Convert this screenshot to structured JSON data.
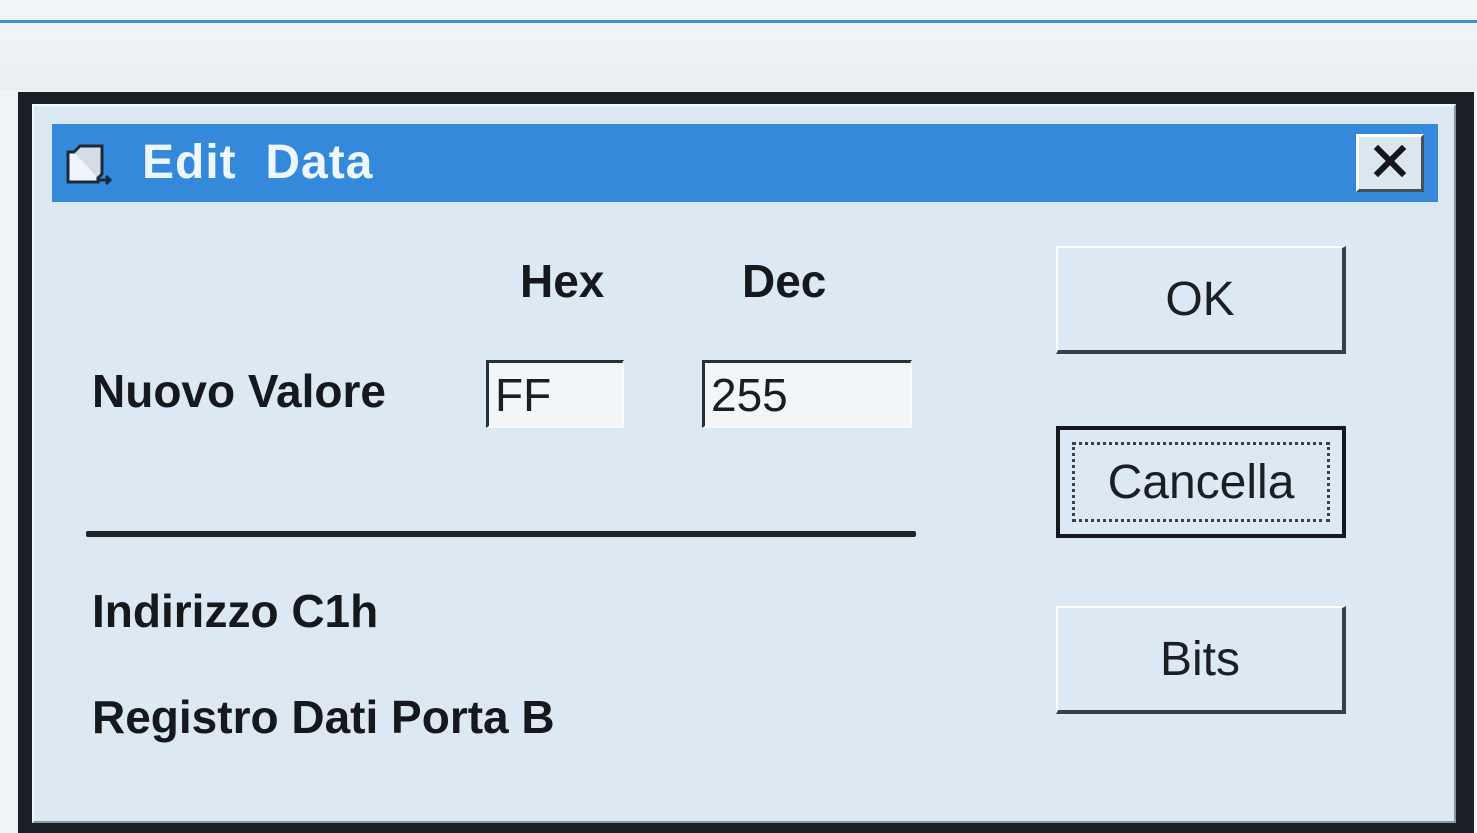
{
  "window": {
    "title": "Edit  Data",
    "close_label": "×"
  },
  "columns": {
    "hex": "Hex",
    "dec": "Dec"
  },
  "value_row": {
    "label": "Nuovo Valore",
    "hex_value": "FF",
    "dec_value": "255"
  },
  "info": {
    "address": "Indirizzo C1h",
    "register": "Registro Dati Porta B"
  },
  "buttons": {
    "ok": "OK",
    "cancel": "Cancella",
    "bits": "Bits"
  },
  "icons": {
    "title": "window-app-icon",
    "close": "close-icon"
  },
  "colors": {
    "titlebar": "#3589db",
    "dialog_bg": "#dce9f2"
  }
}
